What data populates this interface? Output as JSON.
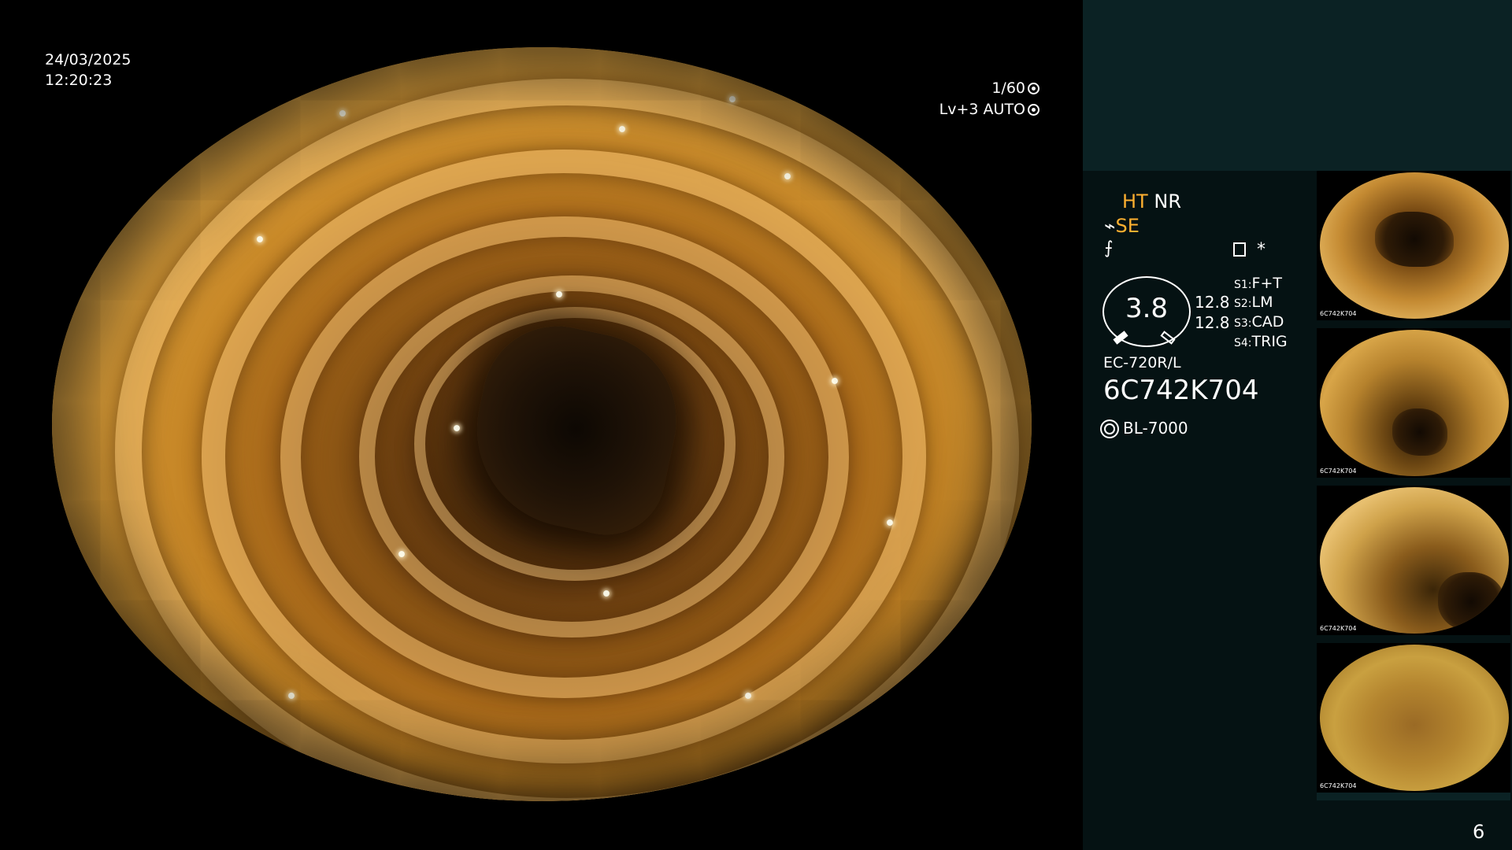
{
  "overlay": {
    "date": "24/03/2025",
    "time": "12:20:23",
    "shutter": "1/60",
    "level": "Lv+3 AUTO"
  },
  "info": {
    "ht": "HT",
    "nr": "NR",
    "se": "SE",
    "memo_mark": "*",
    "gauge_value": "3.8",
    "num_a": "12.8",
    "num_b": "12.8",
    "switches": [
      {
        "key": "S1:",
        "value": "F+T"
      },
      {
        "key": "S2:",
        "value": "LM"
      },
      {
        "key": "S3:",
        "value": "CAD"
      },
      {
        "key": "S4:",
        "value": "TRIG"
      }
    ],
    "scope_model": "EC-720R/L",
    "serial_no": "6C742K704",
    "light_source": "BL-7000"
  },
  "thumbnails": [
    {
      "serial": "6C742K704"
    },
    {
      "serial": "6C742K704"
    },
    {
      "serial": "6C742K704"
    },
    {
      "serial": "6C742K704"
    }
  ],
  "page_number": "6",
  "colors": {
    "panel_top": "#0b2224",
    "panel": "#051213",
    "accent_orange": "#ffb030"
  },
  "icons": {
    "shutter": "shutter-icon",
    "auto": "auto-iris-icon",
    "structure": "structure-enhance-icon",
    "freeze": "freeze-icon",
    "memo": "memo-icon",
    "light": "light-source-icon"
  }
}
